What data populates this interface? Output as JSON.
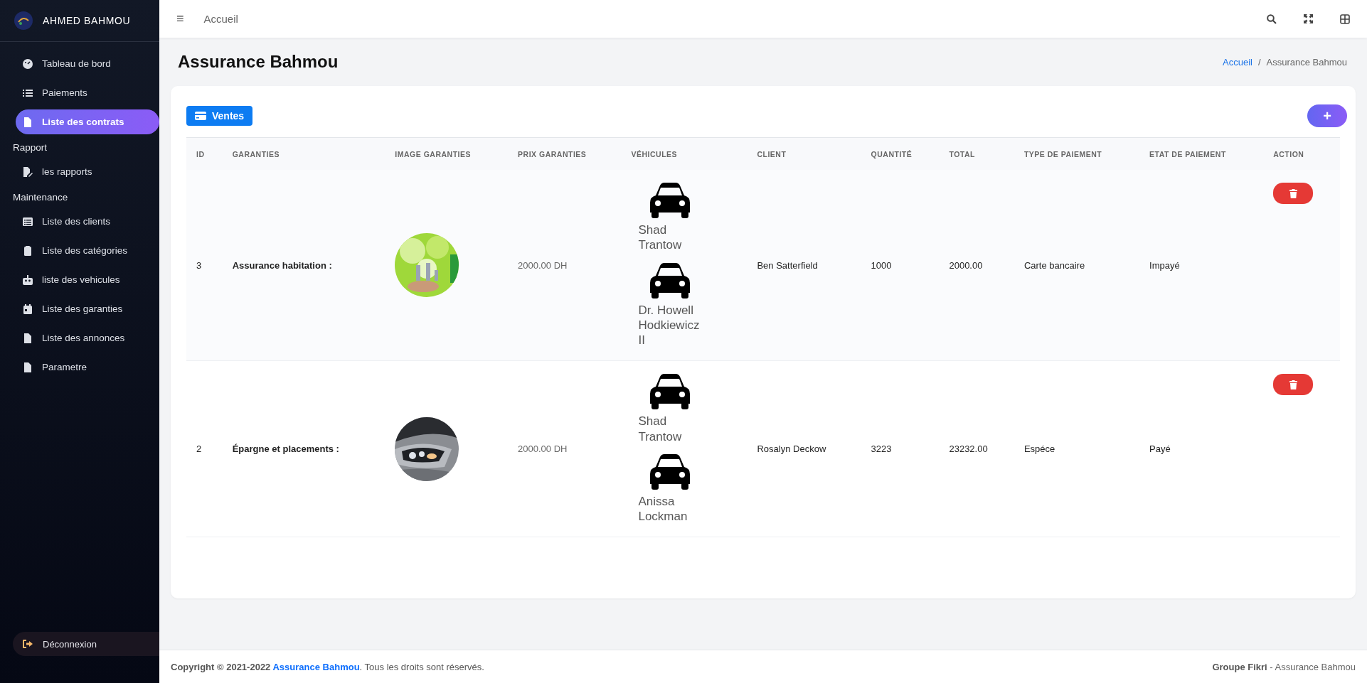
{
  "sidebar": {
    "brand": "AHMED BAHMOU",
    "items": [
      {
        "kind": "link",
        "label": "Tableau de bord",
        "selected": false
      },
      {
        "kind": "link",
        "label": "Paiements",
        "selected": false
      },
      {
        "kind": "link",
        "label": "Liste des contrats",
        "selected": true
      },
      {
        "kind": "section",
        "label": "Rapport"
      },
      {
        "kind": "link",
        "label": "les rapports",
        "selected": false
      },
      {
        "kind": "section",
        "label": "Maintenance"
      },
      {
        "kind": "link",
        "label": "Liste des clients",
        "selected": false
      },
      {
        "kind": "link",
        "label": "Liste des catégories",
        "selected": false
      },
      {
        "kind": "link",
        "label": "liste des vehicules",
        "selected": false
      },
      {
        "kind": "link",
        "label": "Liste des garanties",
        "selected": false
      },
      {
        "kind": "link",
        "label": "Liste des annonces",
        "selected": false
      },
      {
        "kind": "link",
        "label": "Parametre",
        "selected": false
      }
    ],
    "logout": "Déconnexion"
  },
  "topbar": {
    "menu_icon": "≡",
    "breadcrumb_link": "Accueil"
  },
  "page": {
    "title": "Assurance Bahmou",
    "separator": "/",
    "breadcrumb": [
      {
        "label": "Accueil",
        "kind": "link"
      },
      {
        "label": "Assurance Bahmou",
        "kind": "current"
      }
    ]
  },
  "card": {
    "sales_button": "Ventes",
    "add_button": "+",
    "table": {
      "columns": [
        "ID",
        "GARANTIES",
        "IMAGE GARANTIES",
        "PRIX GARANTIES",
        "VÉHICULES",
        "CLIENT",
        "QUANTITÉ",
        "TOTAL",
        "TYPE DE PAIEMENT",
        "ETAT DE PAIEMENT",
        "ACTION"
      ],
      "rows": [
        {
          "id": "3",
          "guarantee": "Assurance habitation :",
          "price": "2000.00 DH",
          "vehicles": [
            "Shad Trantow",
            "Dr. Howell Hodkiewicz II"
          ],
          "client": "Ben Satterfield",
          "quantity": "1000",
          "total": "2000.00",
          "payment_type": "Carte bancaire",
          "payment_state": "Impayé"
        },
        {
          "id": "2",
          "guarantee": "Épargne et placements :",
          "price": "2000.00 DH",
          "vehicles": [
            "Shad Trantow",
            "Anissa Lockman"
          ],
          "client": "Rosalyn Deckow",
          "quantity": "3223",
          "total": "23232.00",
          "payment_type": "Espéce",
          "payment_state": "Payé"
        }
      ]
    }
  },
  "footer": {
    "copyright": "Copyright © 2021-2022",
    "link": "Assurance Bahmou",
    "suffix": ". Tous les droits sont réservés.",
    "company": "Groupe Fikri",
    "company_suffix": " - Assurance Bahmou"
  }
}
